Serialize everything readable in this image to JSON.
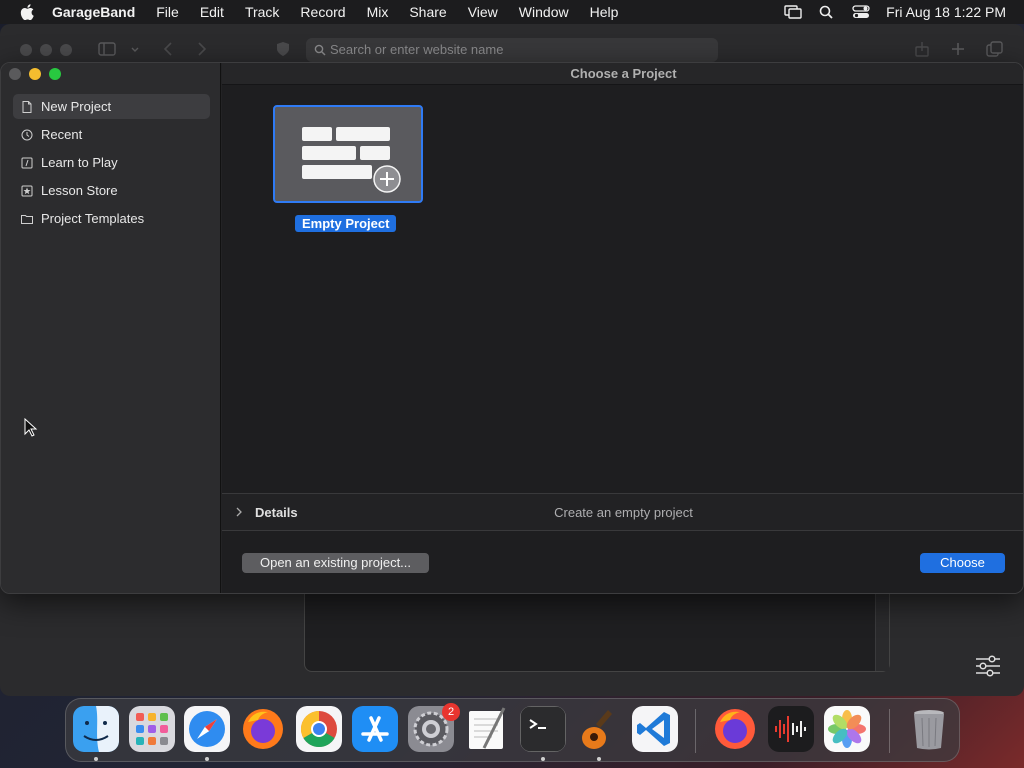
{
  "menubar": {
    "app_name": "GarageBand",
    "items": [
      "File",
      "Edit",
      "Track",
      "Record",
      "Mix",
      "Share",
      "View",
      "Window",
      "Help"
    ],
    "clock": "Fri Aug 18  1:22 PM"
  },
  "browser": {
    "address_placeholder": "Search or enter website name"
  },
  "dialog": {
    "title": "Choose a Project",
    "sidebar": [
      {
        "label": "New Project",
        "icon": "document-icon",
        "selected": true
      },
      {
        "label": "Recent",
        "icon": "clock-icon"
      },
      {
        "label": "Learn to Play",
        "icon": "music-note-icon"
      },
      {
        "label": "Lesson Store",
        "icon": "star-icon"
      },
      {
        "label": "Project Templates",
        "icon": "folder-icon"
      }
    ],
    "project": {
      "label": "Empty Project"
    },
    "details_label": "Details",
    "details_description": "Create an empty project",
    "open_existing_label": "Open an existing project...",
    "choose_label": "Choose"
  },
  "dock": {
    "apps": [
      "finder-icon",
      "launchpad-icon",
      "safari-icon",
      "firefox-icon",
      "chrome-icon",
      "app-store-icon",
      "system-settings-icon",
      "textedit-icon",
      "terminal-icon",
      "garageband-icon",
      "vscode-icon",
      "firefox-dev-icon",
      "voice-memos-icon",
      "photos-icon",
      "trash-icon"
    ],
    "settings_badge": "2"
  },
  "colors": {
    "accent": "#1f6fe0",
    "selection_border": "#2f7bf5",
    "badge": "#e8352f"
  }
}
